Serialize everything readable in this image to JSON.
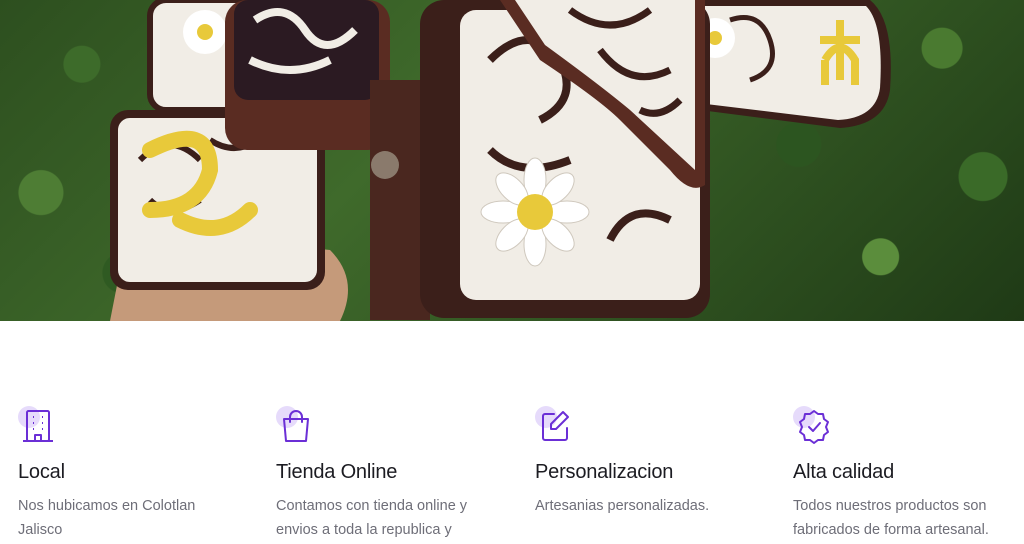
{
  "hero": {
    "image_icon": "embroidered-leather-holsters-photo",
    "colors": {
      "leather": "#3b1f1a",
      "embroidery": "#f2efe9",
      "gold": "#e8c93a",
      "foliage": "#3f6a2b"
    }
  },
  "features": [
    {
      "icon": "building-icon",
      "title": "Local",
      "description": "Nos hubicamos en Colotlan Jalisco"
    },
    {
      "icon": "shopping-bag-icon",
      "title": "Tienda Online",
      "description": "Contamos con tienda online y envios a toda la republica y"
    },
    {
      "icon": "edit-icon",
      "title": "Personalizacion",
      "description": "Artesanias personalizadas."
    },
    {
      "icon": "badge-check-icon",
      "title": "Alta calidad",
      "description": "Todos nuestros productos son fabricados de forma artesanal."
    }
  ],
  "accent_color": "#6b2fd6",
  "accent_soft": "#e6dbfb"
}
